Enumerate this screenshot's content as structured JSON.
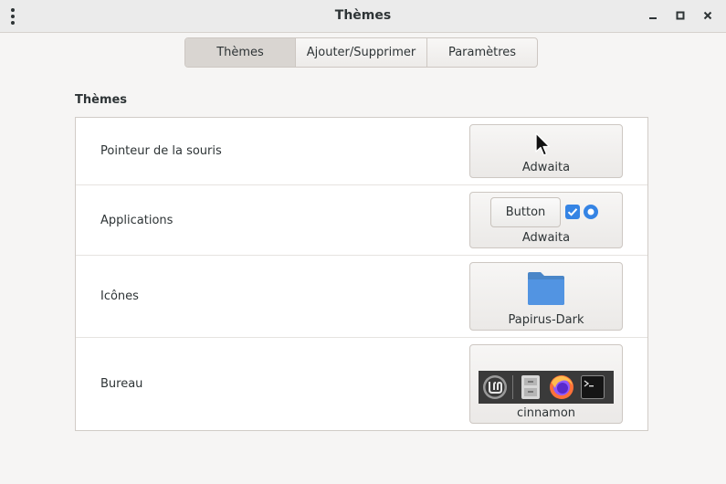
{
  "window": {
    "title": "Thèmes"
  },
  "tabs": [
    {
      "label": "Thèmes",
      "active": true
    },
    {
      "label": "Ajouter/Supprimer",
      "active": false
    },
    {
      "label": "Paramètres",
      "active": false
    }
  ],
  "section": {
    "title": "Thèmes"
  },
  "rows": [
    {
      "label": "Pointeur de la souris",
      "value": "Adwaita",
      "preview": "cursor-arrow-icon"
    },
    {
      "label": "Applications",
      "value": "Adwaita",
      "preview_button": "Button"
    },
    {
      "label": "Icônes",
      "value": "Papirus-Dark",
      "preview": "folder-icon"
    },
    {
      "label": "Bureau",
      "value": "cinnamon",
      "preview": "panel-preview"
    }
  ],
  "colors": {
    "accent": "#3584e4",
    "folder": "#5294e2",
    "titlebar": "#ebebeb",
    "background": "#f6f5f4"
  }
}
